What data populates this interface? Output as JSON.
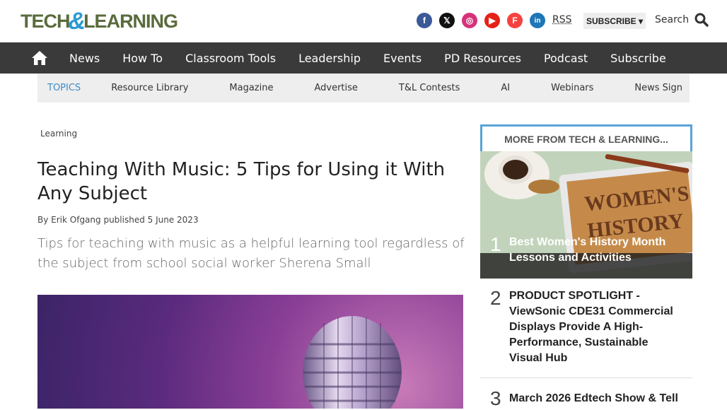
{
  "header": {
    "logo_text_left": "TECH",
    "logo_amp": "&",
    "logo_text_right": "LEARNING",
    "rss": "RSS",
    "subscribe": "SUBSCRIBE ▾",
    "search": "Search",
    "social": [
      {
        "icon": "facebook-icon",
        "glyph": "f"
      },
      {
        "icon": "x-icon",
        "glyph": "𝕏"
      },
      {
        "icon": "instagram-icon",
        "glyph": "◎"
      },
      {
        "icon": "youtube-icon",
        "glyph": "▶"
      },
      {
        "icon": "flipboard-icon",
        "glyph": "F"
      },
      {
        "icon": "linkedin-icon",
        "glyph": "in"
      }
    ]
  },
  "nav": {
    "home_icon": "home-icon",
    "items": [
      "News",
      "How To",
      "Classroom Tools",
      "Leadership",
      "Events",
      "PD Resources",
      "Podcast",
      "Subscribe"
    ]
  },
  "topics": {
    "label": "TOPICS",
    "items": [
      "Resource Library",
      "Magazine",
      "Advertise",
      "T&L Contests",
      "AI",
      "Webinars",
      "News Sign"
    ]
  },
  "article": {
    "breadcrumb": "Learning",
    "title": "Teaching With Music: 5 Tips for Using it With Any Subject",
    "byline_prefix": "By ",
    "author": "Erik Ofgang",
    "published_prefix": " published ",
    "date": "5 June 2023",
    "dek": "Tips for teaching with music as a helpful learning tool regardless of the subject from school social worker Sherena Small"
  },
  "sidebar": {
    "heading": "MORE FROM TECH & LEARNING...",
    "items": [
      {
        "num": "1",
        "title": "Best Women's History Month Lessons and Activities"
      },
      {
        "num": "2",
        "title": "PRODUCT SPOTLIGHT - ViewSonic CDE31 Commercial Displays Provide A High-Performance, Sustainable Visual Hub"
      },
      {
        "num": "3",
        "title": "March 2026 Edtech Show & Tell"
      }
    ],
    "image_words": "WOMEN'S HISTORY"
  },
  "colors": {
    "nav_bg": "#3a3a3a",
    "accent_blue": "#3e8bc6",
    "logo_green": "#5a6b3d"
  }
}
